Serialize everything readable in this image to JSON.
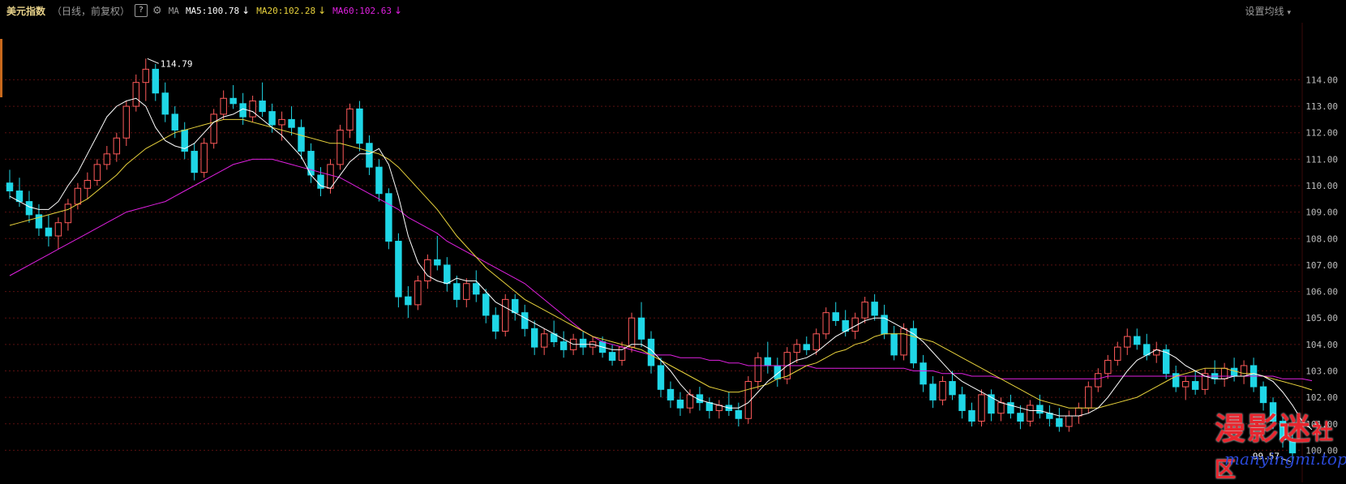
{
  "header": {
    "title": "美元指数",
    "subtitle": "（日线，前复权）",
    "help_label": "?",
    "ma_label": "MA",
    "ma5": "MA5:100.78",
    "ma20": "MA20:102.28",
    "ma60": "MA60:102.63",
    "arrow": "↓",
    "settings_label": "设置均线",
    "settings_chevron": "▾"
  },
  "colors": {
    "up": "#ff5a5a",
    "down": "#1fd6e6",
    "ma5": "#ffffff",
    "ma20": "#e8d23c",
    "ma60": "#e020e0",
    "grid": "#5a1010",
    "title": "#e8d28a",
    "axis_text": "#bdbdbd"
  },
  "watermark": {
    "text": "漫影迷",
    "small": "社区",
    "url": "manyingmi.top"
  },
  "chart_data": {
    "type": "candlestick",
    "y_ticks": [
      "114.00",
      "113.00",
      "112.00",
      "111.00",
      "110.00",
      "109.00",
      "108.00",
      "107.00",
      "106.00",
      "105.00",
      "104.00",
      "103.00",
      "102.00",
      "101.00",
      "100.00"
    ],
    "ylim": [
      99.4,
      115.3
    ],
    "grid": true,
    "annotations": {
      "high": "114.79",
      "low": "99.57"
    },
    "ohlc": [
      [
        110.1,
        110.6,
        109.5,
        109.8
      ],
      [
        109.8,
        110.3,
        109.2,
        109.4
      ],
      [
        109.4,
        109.8,
        108.6,
        108.9
      ],
      [
        108.9,
        109.3,
        108.1,
        108.4
      ],
      [
        108.4,
        108.9,
        107.7,
        108.1
      ],
      [
        108.1,
        108.8,
        107.6,
        108.6
      ],
      [
        108.6,
        109.5,
        108.3,
        109.3
      ],
      [
        109.3,
        110.1,
        109.1,
        109.9
      ],
      [
        109.9,
        110.5,
        109.5,
        110.2
      ],
      [
        110.2,
        111.0,
        110.0,
        110.8
      ],
      [
        110.8,
        111.5,
        110.6,
        111.2
      ],
      [
        111.2,
        112.0,
        110.9,
        111.8
      ],
      [
        111.8,
        113.2,
        111.5,
        113.0
      ],
      [
        113.0,
        114.2,
        112.8,
        113.9
      ],
      [
        113.9,
        114.8,
        113.2,
        114.4
      ],
      [
        114.4,
        114.6,
        113.2,
        113.5
      ],
      [
        113.5,
        113.9,
        112.4,
        112.7
      ],
      [
        112.7,
        113.0,
        111.8,
        112.1
      ],
      [
        112.1,
        112.4,
        111.0,
        111.3
      ],
      [
        111.3,
        111.6,
        110.2,
        110.5
      ],
      [
        110.5,
        111.8,
        110.3,
        111.6
      ],
      [
        111.6,
        112.9,
        111.4,
        112.7
      ],
      [
        112.7,
        113.6,
        112.5,
        113.3
      ],
      [
        113.3,
        113.8,
        112.9,
        113.1
      ],
      [
        113.1,
        113.5,
        112.3,
        112.6
      ],
      [
        112.6,
        113.4,
        112.4,
        113.2
      ],
      [
        113.2,
        113.9,
        112.6,
        112.8
      ],
      [
        112.8,
        113.1,
        112.0,
        112.3
      ],
      [
        112.3,
        112.8,
        111.7,
        112.5
      ],
      [
        112.5,
        113.0,
        111.9,
        112.2
      ],
      [
        112.2,
        112.5,
        111.0,
        111.3
      ],
      [
        111.3,
        111.6,
        110.1,
        110.4
      ],
      [
        110.4,
        110.7,
        109.6,
        109.9
      ],
      [
        109.9,
        111.0,
        109.7,
        110.8
      ],
      [
        110.8,
        112.3,
        110.6,
        112.1
      ],
      [
        112.1,
        113.1,
        111.8,
        112.9
      ],
      [
        112.9,
        113.2,
        111.3,
        111.6
      ],
      [
        111.6,
        111.9,
        110.4,
        110.7
      ],
      [
        110.7,
        111.0,
        109.4,
        109.7
      ],
      [
        109.7,
        109.9,
        107.6,
        107.9
      ],
      [
        107.9,
        108.2,
        105.4,
        105.8
      ],
      [
        105.8,
        106.2,
        105.0,
        105.5
      ],
      [
        105.5,
        106.6,
        105.3,
        106.4
      ],
      [
        106.4,
        107.4,
        106.1,
        107.2
      ],
      [
        107.2,
        108.1,
        106.8,
        107.0
      ],
      [
        107.0,
        107.3,
        106.0,
        106.3
      ],
      [
        106.3,
        106.6,
        105.4,
        105.7
      ],
      [
        105.7,
        106.5,
        105.4,
        106.3
      ],
      [
        106.3,
        106.8,
        105.6,
        105.9
      ],
      [
        105.9,
        106.1,
        104.8,
        105.1
      ],
      [
        105.1,
        105.4,
        104.2,
        104.5
      ],
      [
        104.5,
        105.9,
        104.3,
        105.7
      ],
      [
        105.7,
        105.9,
        104.9,
        105.2
      ],
      [
        105.2,
        105.5,
        104.3,
        104.6
      ],
      [
        104.6,
        104.9,
        103.6,
        103.9
      ],
      [
        103.9,
        104.6,
        103.6,
        104.4
      ],
      [
        104.4,
        104.9,
        103.9,
        104.1
      ],
      [
        104.1,
        104.5,
        103.5,
        103.8
      ],
      [
        103.8,
        104.4,
        103.6,
        104.2
      ],
      [
        104.2,
        104.5,
        103.6,
        103.9
      ],
      [
        103.9,
        104.3,
        103.6,
        104.1
      ],
      [
        104.1,
        104.3,
        103.5,
        103.7
      ],
      [
        103.7,
        104.0,
        103.2,
        103.4
      ],
      [
        103.4,
        104.1,
        103.2,
        103.9
      ],
      [
        103.9,
        105.2,
        103.7,
        105.0
      ],
      [
        105.0,
        105.6,
        103.9,
        104.2
      ],
      [
        104.2,
        104.5,
        102.9,
        103.2
      ],
      [
        103.2,
        103.5,
        102.0,
        102.3
      ],
      [
        102.3,
        102.6,
        101.6,
        101.9
      ],
      [
        101.9,
        102.2,
        101.3,
        101.6
      ],
      [
        101.6,
        102.3,
        101.4,
        102.1
      ],
      [
        102.1,
        102.4,
        101.5,
        101.8
      ],
      [
        101.8,
        102.0,
        101.2,
        101.5
      ],
      [
        101.5,
        101.9,
        101.2,
        101.7
      ],
      [
        101.7,
        102.2,
        101.3,
        101.5
      ],
      [
        101.5,
        101.8,
        100.9,
        101.2
      ],
      [
        101.2,
        102.8,
        101.0,
        102.6
      ],
      [
        102.6,
        103.7,
        102.3,
        103.5
      ],
      [
        103.5,
        104.1,
        102.9,
        103.2
      ],
      [
        103.2,
        103.5,
        102.4,
        102.7
      ],
      [
        102.7,
        103.9,
        102.5,
        103.7
      ],
      [
        103.7,
        104.2,
        103.3,
        104.0
      ],
      [
        104.0,
        104.3,
        103.6,
        103.8
      ],
      [
        103.8,
        104.6,
        103.6,
        104.4
      ],
      [
        104.4,
        105.4,
        104.2,
        105.2
      ],
      [
        105.2,
        105.6,
        104.7,
        104.9
      ],
      [
        104.9,
        105.3,
        104.3,
        104.5
      ],
      [
        104.5,
        105.2,
        104.2,
        105.0
      ],
      [
        105.0,
        105.8,
        104.8,
        105.6
      ],
      [
        105.6,
        105.9,
        104.9,
        105.1
      ],
      [
        105.1,
        105.5,
        104.2,
        104.4
      ],
      [
        104.4,
        104.7,
        103.4,
        103.6
      ],
      [
        103.6,
        104.8,
        103.4,
        104.6
      ],
      [
        104.6,
        104.9,
        103.1,
        103.3
      ],
      [
        103.3,
        103.6,
        102.2,
        102.5
      ],
      [
        102.5,
        102.8,
        101.6,
        101.9
      ],
      [
        101.9,
        102.8,
        101.7,
        102.6
      ],
      [
        102.6,
        103.0,
        101.9,
        102.1
      ],
      [
        102.1,
        102.4,
        101.2,
        101.5
      ],
      [
        101.5,
        101.8,
        100.9,
        101.1
      ],
      [
        101.1,
        102.3,
        100.9,
        102.1
      ],
      [
        102.1,
        102.3,
        101.1,
        101.4
      ],
      [
        101.4,
        102.0,
        101.1,
        101.8
      ],
      [
        101.8,
        102.1,
        101.2,
        101.4
      ],
      [
        101.4,
        101.7,
        100.8,
        101.1
      ],
      [
        101.1,
        101.9,
        100.9,
        101.7
      ],
      [
        101.7,
        102.1,
        101.2,
        101.4
      ],
      [
        101.4,
        101.7,
        100.9,
        101.2
      ],
      [
        101.2,
        101.6,
        100.7,
        100.9
      ],
      [
        100.9,
        101.5,
        100.7,
        101.3
      ],
      [
        101.3,
        101.8,
        101.0,
        101.6
      ],
      [
        101.6,
        102.6,
        101.4,
        102.4
      ],
      [
        102.4,
        103.1,
        102.2,
        102.9
      ],
      [
        102.9,
        103.6,
        102.7,
        103.4
      ],
      [
        103.4,
        104.1,
        103.2,
        103.9
      ],
      [
        103.9,
        104.6,
        103.6,
        104.3
      ],
      [
        104.3,
        104.6,
        103.8,
        104.0
      ],
      [
        104.0,
        104.4,
        103.4,
        103.6
      ],
      [
        103.6,
        104.1,
        103.3,
        103.8
      ],
      [
        103.8,
        104.0,
        102.7,
        102.9
      ],
      [
        102.9,
        103.2,
        102.2,
        102.4
      ],
      [
        102.4,
        102.8,
        101.9,
        102.6
      ],
      [
        102.6,
        103.0,
        102.1,
        102.3
      ],
      [
        102.3,
        103.1,
        102.1,
        102.9
      ],
      [
        102.9,
        103.4,
        102.5,
        102.7
      ],
      [
        102.7,
        103.3,
        102.4,
        103.1
      ],
      [
        103.1,
        103.5,
        102.6,
        102.8
      ],
      [
        102.8,
        103.4,
        102.5,
        103.2
      ],
      [
        103.2,
        103.5,
        102.2,
        102.4
      ],
      [
        102.4,
        102.6,
        101.5,
        101.8
      ],
      [
        101.8,
        102.0,
        100.8,
        101.1
      ],
      [
        101.1,
        101.3,
        100.1,
        100.4
      ],
      [
        100.4,
        100.6,
        99.57,
        99.9
      ]
    ],
    "ma5": [
      109.6,
      109.4,
      109.2,
      109.1,
      109.1,
      109.4,
      110.0,
      110.5,
      111.2,
      111.9,
      112.6,
      113.0,
      113.2,
      113.3,
      113.0,
      112.2,
      111.7,
      111.5,
      111.4,
      111.6,
      112.0,
      112.4,
      112.6,
      112.7,
      112.9,
      112.8,
      112.5,
      112.2,
      111.9,
      111.5,
      111.1,
      110.4,
      110.0,
      109.9,
      110.4,
      110.9,
      111.2,
      111.2,
      111.4,
      110.8,
      109.6,
      108.1,
      107.1,
      106.6,
      106.4,
      106.3,
      106.5,
      106.4,
      106.4,
      106.0,
      105.6,
      105.4,
      105.2,
      105.0,
      104.8,
      104.6,
      104.4,
      104.2,
      104.0,
      104.0,
      104.0,
      103.9,
      103.8,
      103.8,
      104.0,
      104.0,
      103.8,
      103.4,
      103.0,
      102.5,
      102.1,
      101.9,
      101.8,
      101.7,
      101.6,
      101.6,
      101.8,
      102.2,
      102.6,
      102.9,
      103.2,
      103.4,
      103.5,
      103.7,
      104.0,
      104.3,
      104.5,
      104.7,
      104.9,
      105.0,
      105.0,
      104.8,
      104.6,
      104.4,
      104.1,
      103.7,
      103.3,
      102.9,
      102.6,
      102.4,
      102.2,
      102.0,
      101.8,
      101.7,
      101.6,
      101.5,
      101.5,
      101.4,
      101.3,
      101.3,
      101.3,
      101.4,
      101.6,
      102.0,
      102.5,
      103.0,
      103.4,
      103.6,
      103.8,
      103.7,
      103.5,
      103.2,
      103.0,
      102.8,
      102.7,
      102.7,
      102.8,
      102.8,
      102.9,
      102.8,
      102.6,
      102.2,
      101.7,
      101.1,
      100.78
    ],
    "ma20": [
      108.5,
      108.6,
      108.7,
      108.8,
      108.9,
      109.0,
      109.1,
      109.3,
      109.5,
      109.8,
      110.1,
      110.4,
      110.8,
      111.1,
      111.4,
      111.6,
      111.8,
      112.0,
      112.1,
      112.2,
      112.3,
      112.4,
      112.5,
      112.5,
      112.5,
      112.4,
      112.3,
      112.2,
      112.1,
      112.0,
      111.9,
      111.8,
      111.7,
      111.6,
      111.6,
      111.5,
      111.4,
      111.3,
      111.2,
      111.0,
      110.7,
      110.3,
      109.9,
      109.5,
      109.1,
      108.6,
      108.1,
      107.7,
      107.3,
      106.9,
      106.6,
      106.3,
      106.0,
      105.7,
      105.5,
      105.3,
      105.1,
      104.9,
      104.7,
      104.5,
      104.3,
      104.2,
      104.1,
      104.0,
      103.9,
      103.8,
      103.6,
      103.4,
      103.2,
      103.0,
      102.8,
      102.6,
      102.4,
      102.3,
      102.2,
      102.2,
      102.3,
      102.4,
      102.5,
      102.7,
      102.8,
      103.0,
      103.2,
      103.3,
      103.5,
      103.7,
      103.8,
      104.0,
      104.1,
      104.3,
      104.4,
      104.4,
      104.4,
      104.3,
      104.2,
      104.1,
      103.9,
      103.7,
      103.5,
      103.3,
      103.1,
      102.9,
      102.7,
      102.5,
      102.3,
      102.1,
      101.9,
      101.8,
      101.7,
      101.6,
      101.6,
      101.6,
      101.6,
      101.7,
      101.8,
      101.9,
      102.0,
      102.2,
      102.4,
      102.6,
      102.8,
      102.9,
      103.0,
      103.1,
      103.1,
      103.1,
      103.0,
      102.9,
      102.9,
      102.8,
      102.7,
      102.6,
      102.5,
      102.4,
      102.28
    ],
    "ma60": [
      106.6,
      106.8,
      107.0,
      107.2,
      107.4,
      107.6,
      107.8,
      108.0,
      108.2,
      108.4,
      108.6,
      108.8,
      109.0,
      109.1,
      109.2,
      109.3,
      109.4,
      109.6,
      109.8,
      110.0,
      110.2,
      110.4,
      110.6,
      110.8,
      110.9,
      111.0,
      111.0,
      111.0,
      110.9,
      110.8,
      110.7,
      110.6,
      110.5,
      110.4,
      110.3,
      110.1,
      109.9,
      109.7,
      109.5,
      109.3,
      109.1,
      108.8,
      108.6,
      108.4,
      108.2,
      107.9,
      107.7,
      107.5,
      107.3,
      107.1,
      106.9,
      106.7,
      106.5,
      106.3,
      106.0,
      105.7,
      105.4,
      105.1,
      104.8,
      104.5,
      104.3,
      104.1,
      104.0,
      103.9,
      103.8,
      103.7,
      103.6,
      103.6,
      103.6,
      103.5,
      103.5,
      103.5,
      103.4,
      103.4,
      103.3,
      103.3,
      103.2,
      103.2,
      103.2,
      103.2,
      103.2,
      103.2,
      103.2,
      103.1,
      103.1,
      103.1,
      103.1,
      103.1,
      103.1,
      103.1,
      103.1,
      103.1,
      103.1,
      103.0,
      103.0,
      103.0,
      102.9,
      102.9,
      102.9,
      102.8,
      102.8,
      102.8,
      102.7,
      102.7,
      102.7,
      102.7,
      102.7,
      102.7,
      102.7,
      102.7,
      102.7,
      102.7,
      102.7,
      102.8,
      102.8,
      102.8,
      102.8,
      102.8,
      102.8,
      102.8,
      102.8,
      102.8,
      102.8,
      102.8,
      102.8,
      102.8,
      102.8,
      102.8,
      102.8,
      102.8,
      102.8,
      102.7,
      102.7,
      102.7,
      102.63
    ]
  }
}
